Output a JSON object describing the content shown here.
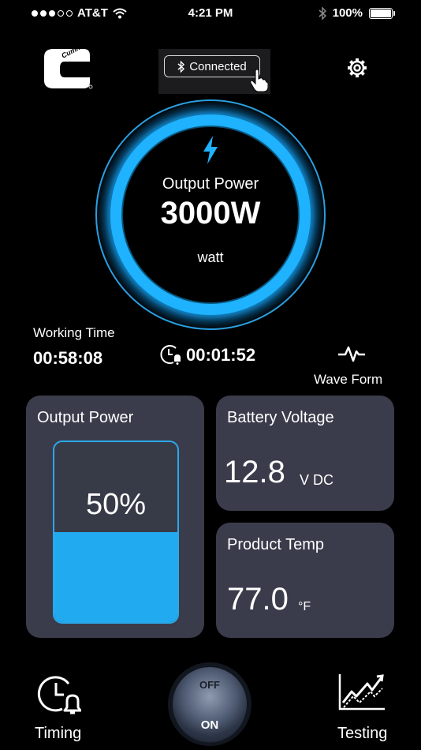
{
  "status_bar": {
    "carrier": "AT&T",
    "time": "4:21 PM",
    "battery": "100%"
  },
  "header": {
    "logo_text": "Cummins",
    "connection_label": "Connected"
  },
  "gauge": {
    "label": "Output Power",
    "value": "3000W",
    "unit": "watt"
  },
  "info": {
    "working_time_label": "Working Time",
    "working_time_value": "00:58:08",
    "timer_value": "00:01:52",
    "wave_form_label": "Wave Form"
  },
  "cards": {
    "output_power": {
      "title": "Output Power",
      "value": "50%",
      "level": 0.5
    },
    "battery_voltage": {
      "title": "Battery Voltage",
      "value": "12.8",
      "unit": "V DC"
    },
    "product_temp": {
      "title": "Product Temp",
      "value": "77.0",
      "unit": "°F"
    }
  },
  "bottom": {
    "timing_label": "Timing",
    "power_off_label": "OFF",
    "power_on_label": "ON",
    "testing_label": "Testing"
  },
  "colors": {
    "accent": "#22aaf0",
    "card_bg": "#3a3c4b",
    "background": "#000000"
  }
}
